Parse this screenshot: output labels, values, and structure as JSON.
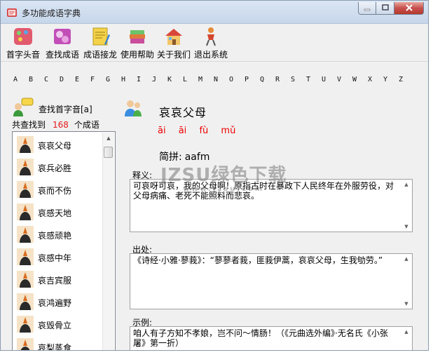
{
  "window": {
    "title": "多功能成语字典"
  },
  "toolbar": {
    "items": [
      {
        "label": "首字头音",
        "icon": "palette-icon"
      },
      {
        "label": "查找成语",
        "icon": "gears-icon"
      },
      {
        "label": "成语接龙",
        "icon": "notepad-pencil-icon"
      },
      {
        "label": "使用帮助",
        "icon": "books-icon"
      },
      {
        "label": "关于我们",
        "icon": "house-icon"
      },
      {
        "label": "退出系统",
        "icon": "exit-person-icon"
      }
    ]
  },
  "alphabet": [
    "A",
    "B",
    "C",
    "D",
    "E",
    "F",
    "G",
    "H",
    "I",
    "J",
    "K",
    "L",
    "M",
    "N",
    "O",
    "P",
    "Q",
    "R",
    "S",
    "T",
    "U",
    "V",
    "W",
    "X",
    "Y",
    "Z"
  ],
  "search": {
    "label": "查找首字音[a]",
    "found_prefix": "共查找到",
    "count": "168",
    "found_suffix": "个成语"
  },
  "idiom_list": [
    "哀哀父母",
    "哀兵必胜",
    "哀而不伤",
    "哀感天地",
    "哀感顽艳",
    "哀感中年",
    "哀吉宾服",
    "哀鸿遍野",
    "哀毁骨立",
    "哀梨蒸食"
  ],
  "detail": {
    "title": "哀哀父母",
    "pinyin": [
      "āi",
      "āi",
      "fù",
      "mǔ"
    ],
    "abbr_label": "简拼:",
    "abbr_value": "aafm",
    "definition_label": "释义:",
    "definition_text": "可哀呀可哀，我的父母啊！原指古时在暴政下人民终年在外服劳役，对父母病痛、老死不能照料而悲哀。",
    "source_label": "出处:",
    "source_text": "《诗经·小雅·蓼莪》：“蓼蓼者莪，匪莪伊蒿，哀哀父母，生我劬劳。”",
    "example_label": "示例:",
    "example_text": "咱人有子方知不孝娘，岂不问～情肠！（《元曲选外编》·无名氏《小张屠》第一折）"
  },
  "watermark": {
    "text": "JZSU绿色下载",
    "sub": "www.jzsu.com"
  },
  "colors": {
    "count": "#e31b1b",
    "pinyin": "#ee0000"
  }
}
